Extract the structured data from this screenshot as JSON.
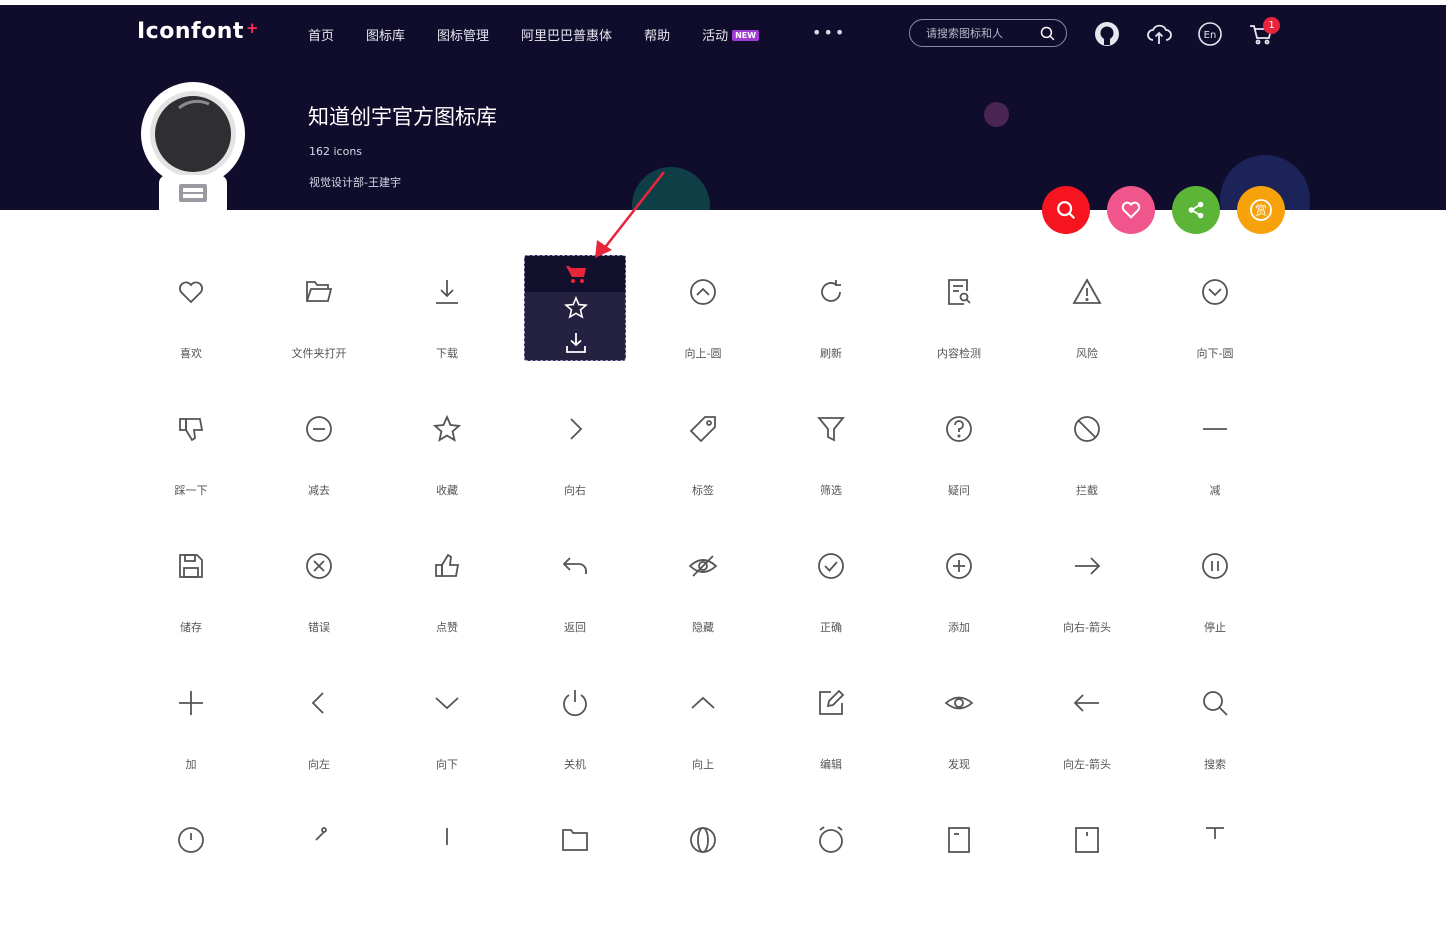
{
  "brand": {
    "logo_text": "Iconfont",
    "logo_plus": "+"
  },
  "nav": {
    "items": [
      "首页",
      "图标库",
      "图标管理",
      "阿里巴巴普惠体",
      "帮助",
      "活动"
    ],
    "new_badge": "NEW",
    "more": "•••"
  },
  "search": {
    "placeholder": "请搜索图标和人"
  },
  "header_icons": [
    "github-icon",
    "upload-cloud-icon",
    "language-en-icon",
    "cart-icon"
  ],
  "language_label": "En",
  "cart": {
    "count": "1"
  },
  "library": {
    "title": "知道创宇官方图标库",
    "count": "162 icons",
    "author": "视觉设计部-王建宇"
  },
  "fabs": [
    {
      "name": "search-fab",
      "icon": "search-icon",
      "color": "#f5141f"
    },
    {
      "name": "favorite-fab",
      "icon": "heart-icon",
      "color": "#f0568c"
    },
    {
      "name": "share-fab",
      "icon": "share-icon",
      "color": "#5cb536"
    },
    {
      "name": "reward-fab",
      "icon": "reward-icon",
      "label": "赏",
      "color": "#f7a10b"
    }
  ],
  "hover_card": {
    "actions": [
      "add-to-cart-icon",
      "star-icon",
      "download-icon"
    ]
  },
  "icons": [
    {
      "label": "喜欢",
      "icon": "heart-icon"
    },
    {
      "label": "文件夹打开",
      "icon": "folder-open-icon"
    },
    {
      "label": "下载",
      "icon": "download-icon"
    },
    {
      "label": "",
      "icon": "hovered-icon"
    },
    {
      "label": "向上-圆",
      "icon": "up-circle-icon"
    },
    {
      "label": "刷新",
      "icon": "refresh-icon"
    },
    {
      "label": "内容检测",
      "icon": "content-check-icon"
    },
    {
      "label": "风险",
      "icon": "warning-icon"
    },
    {
      "label": "向下-圆",
      "icon": "down-circle-icon"
    },
    {
      "label": "踩一下",
      "icon": "thumb-down-icon"
    },
    {
      "label": "减去",
      "icon": "minus-circle-icon"
    },
    {
      "label": "收藏",
      "icon": "star-icon"
    },
    {
      "label": "向右",
      "icon": "chevron-right-icon"
    },
    {
      "label": "标签",
      "icon": "tag-icon"
    },
    {
      "label": "筛选",
      "icon": "filter-icon"
    },
    {
      "label": "疑问",
      "icon": "question-icon"
    },
    {
      "label": "拦截",
      "icon": "block-icon"
    },
    {
      "label": "减",
      "icon": "minus-icon"
    },
    {
      "label": "储存",
      "icon": "save-icon"
    },
    {
      "label": "错误",
      "icon": "error-circle-icon"
    },
    {
      "label": "点赞",
      "icon": "thumb-up-icon"
    },
    {
      "label": "返回",
      "icon": "return-icon"
    },
    {
      "label": "隐藏",
      "icon": "eye-off-icon"
    },
    {
      "label": "正确",
      "icon": "check-circle-icon"
    },
    {
      "label": "添加",
      "icon": "plus-circle-icon"
    },
    {
      "label": "向右-箭头",
      "icon": "arrow-right-icon"
    },
    {
      "label": "停止",
      "icon": "pause-circle-icon"
    },
    {
      "label": "加",
      "icon": "plus-icon"
    },
    {
      "label": "向左",
      "icon": "chevron-left-icon"
    },
    {
      "label": "向下",
      "icon": "chevron-down-icon"
    },
    {
      "label": "关机",
      "icon": "power-icon"
    },
    {
      "label": "向上",
      "icon": "chevron-up-icon"
    },
    {
      "label": "编辑",
      "icon": "edit-icon"
    },
    {
      "label": "发现",
      "icon": "eye-icon"
    },
    {
      "label": "向左-箭头",
      "icon": "arrow-left-icon"
    },
    {
      "label": "搜索",
      "icon": "search-icon"
    }
  ]
}
